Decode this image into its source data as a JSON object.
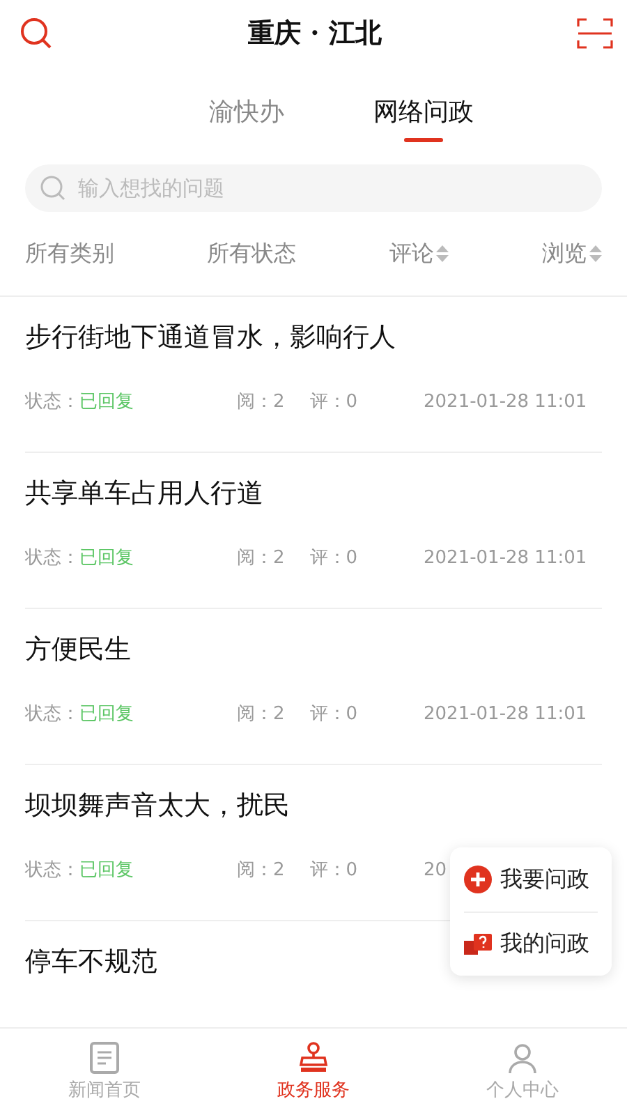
{
  "header": {
    "title": "重庆 · 江北"
  },
  "tabs": [
    {
      "label": "渝快办",
      "selected": false
    },
    {
      "label": "网络问政",
      "selected": true
    }
  ],
  "search": {
    "placeholder": "输入想找的问题"
  },
  "filters": [
    {
      "label": "所有类别",
      "kind": "plain"
    },
    {
      "label": "所有状态",
      "kind": "plain"
    },
    {
      "label": "评论",
      "kind": "sortable"
    },
    {
      "label": "浏览",
      "kind": "sortable"
    }
  ],
  "items": [
    {
      "title": "步行街地下通道冒水，影响行人",
      "status_label": "状态：",
      "status": "已回复",
      "views": "阅：2",
      "comments": "评：0",
      "date": "2021-01-28  11:01"
    },
    {
      "title": "共享单车占用人行道",
      "status_label": "状态：",
      "status": "已回复",
      "views": "阅：2",
      "comments": "评：0",
      "date": "2021-01-28  11:01"
    },
    {
      "title": "方便民生",
      "status_label": "状态：",
      "status": "已回复",
      "views": "阅：2",
      "comments": "评：0",
      "date": "2021-01-28  11:01"
    },
    {
      "title": "坝坝舞声音太大，扰民",
      "status_label": "状态：",
      "status": "已回复",
      "views": "阅：2",
      "comments": "评：0",
      "date": "20"
    },
    {
      "title": "停车不规范"
    }
  ],
  "popup": [
    {
      "label": "我要问政",
      "kind": "ask"
    },
    {
      "label": "我的问政",
      "kind": "mine"
    }
  ],
  "bottom_nav": [
    {
      "label": "新闻首页",
      "kind": "news",
      "selected": false
    },
    {
      "label": "政务服务",
      "kind": "service",
      "selected": true
    },
    {
      "label": "个人中心",
      "kind": "profile",
      "selected": false
    }
  ]
}
